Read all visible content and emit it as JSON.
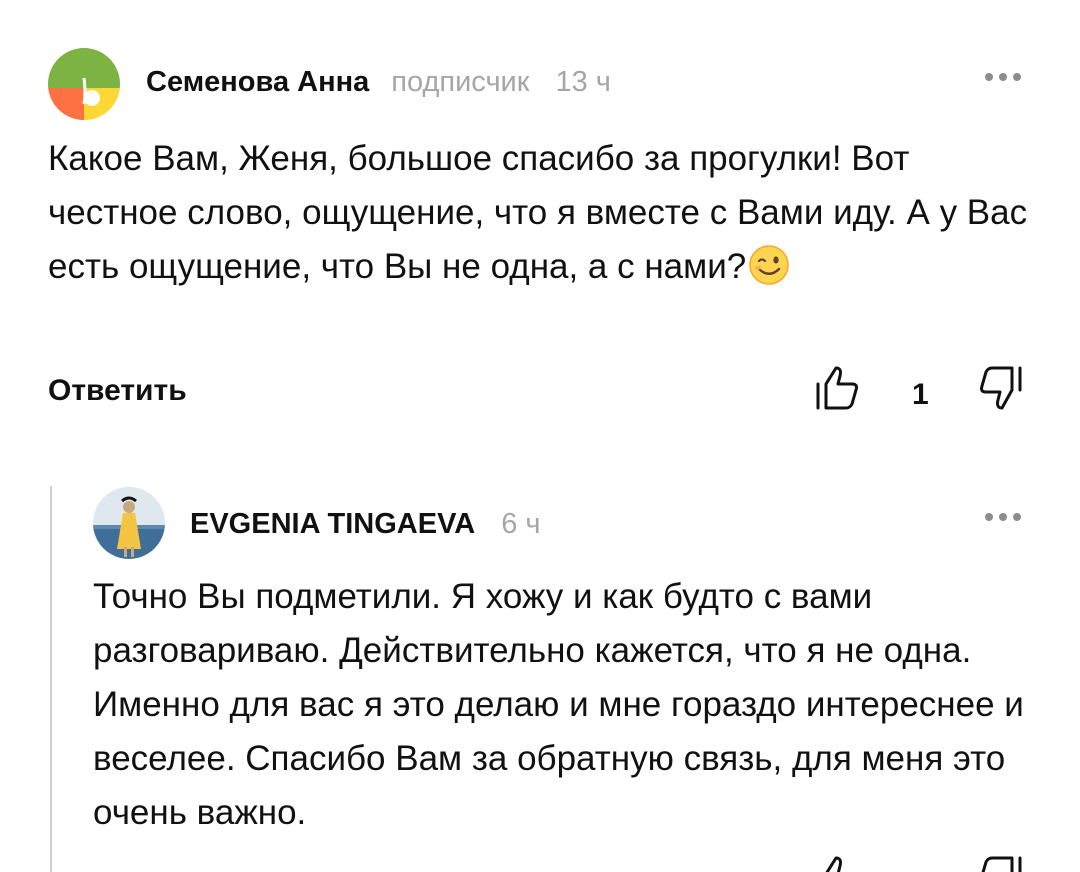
{
  "comments": [
    {
      "author": "Семенова Анна",
      "role": "подписчик",
      "time": "13 ч",
      "text": "Какое Вам, Женя, большое спасибо за прогулки! Вот честное слово,  ощущение, что я вместе с Вами иду. А у Вас есть ощущение, что Вы не одна, а с нами?",
      "emoji": "winking-face-emoji",
      "reply_label": "Ответить",
      "likes": "1",
      "avatar_colors": [
        "#7cb342",
        "#ff7043",
        "#fdd835"
      ]
    },
    {
      "author": "EVGENIA TINGAEVA",
      "time": "6 ч",
      "text": "Точно Вы подметили. Я хожу и как будто с вами разговариваю. Действительно кажется, что я не одна. Именно для вас я это делаю и мне гораздо интереснее и веселее. Спасибо Вам за обратную связь, для меня это очень важно."
    }
  ],
  "colors": {
    "muted_text": "#a6a6a6",
    "thread_line": "#cfcfcf",
    "icon_stroke": "#111111"
  },
  "icons": [
    "more-icon",
    "like-icon",
    "dislike-icon"
  ]
}
